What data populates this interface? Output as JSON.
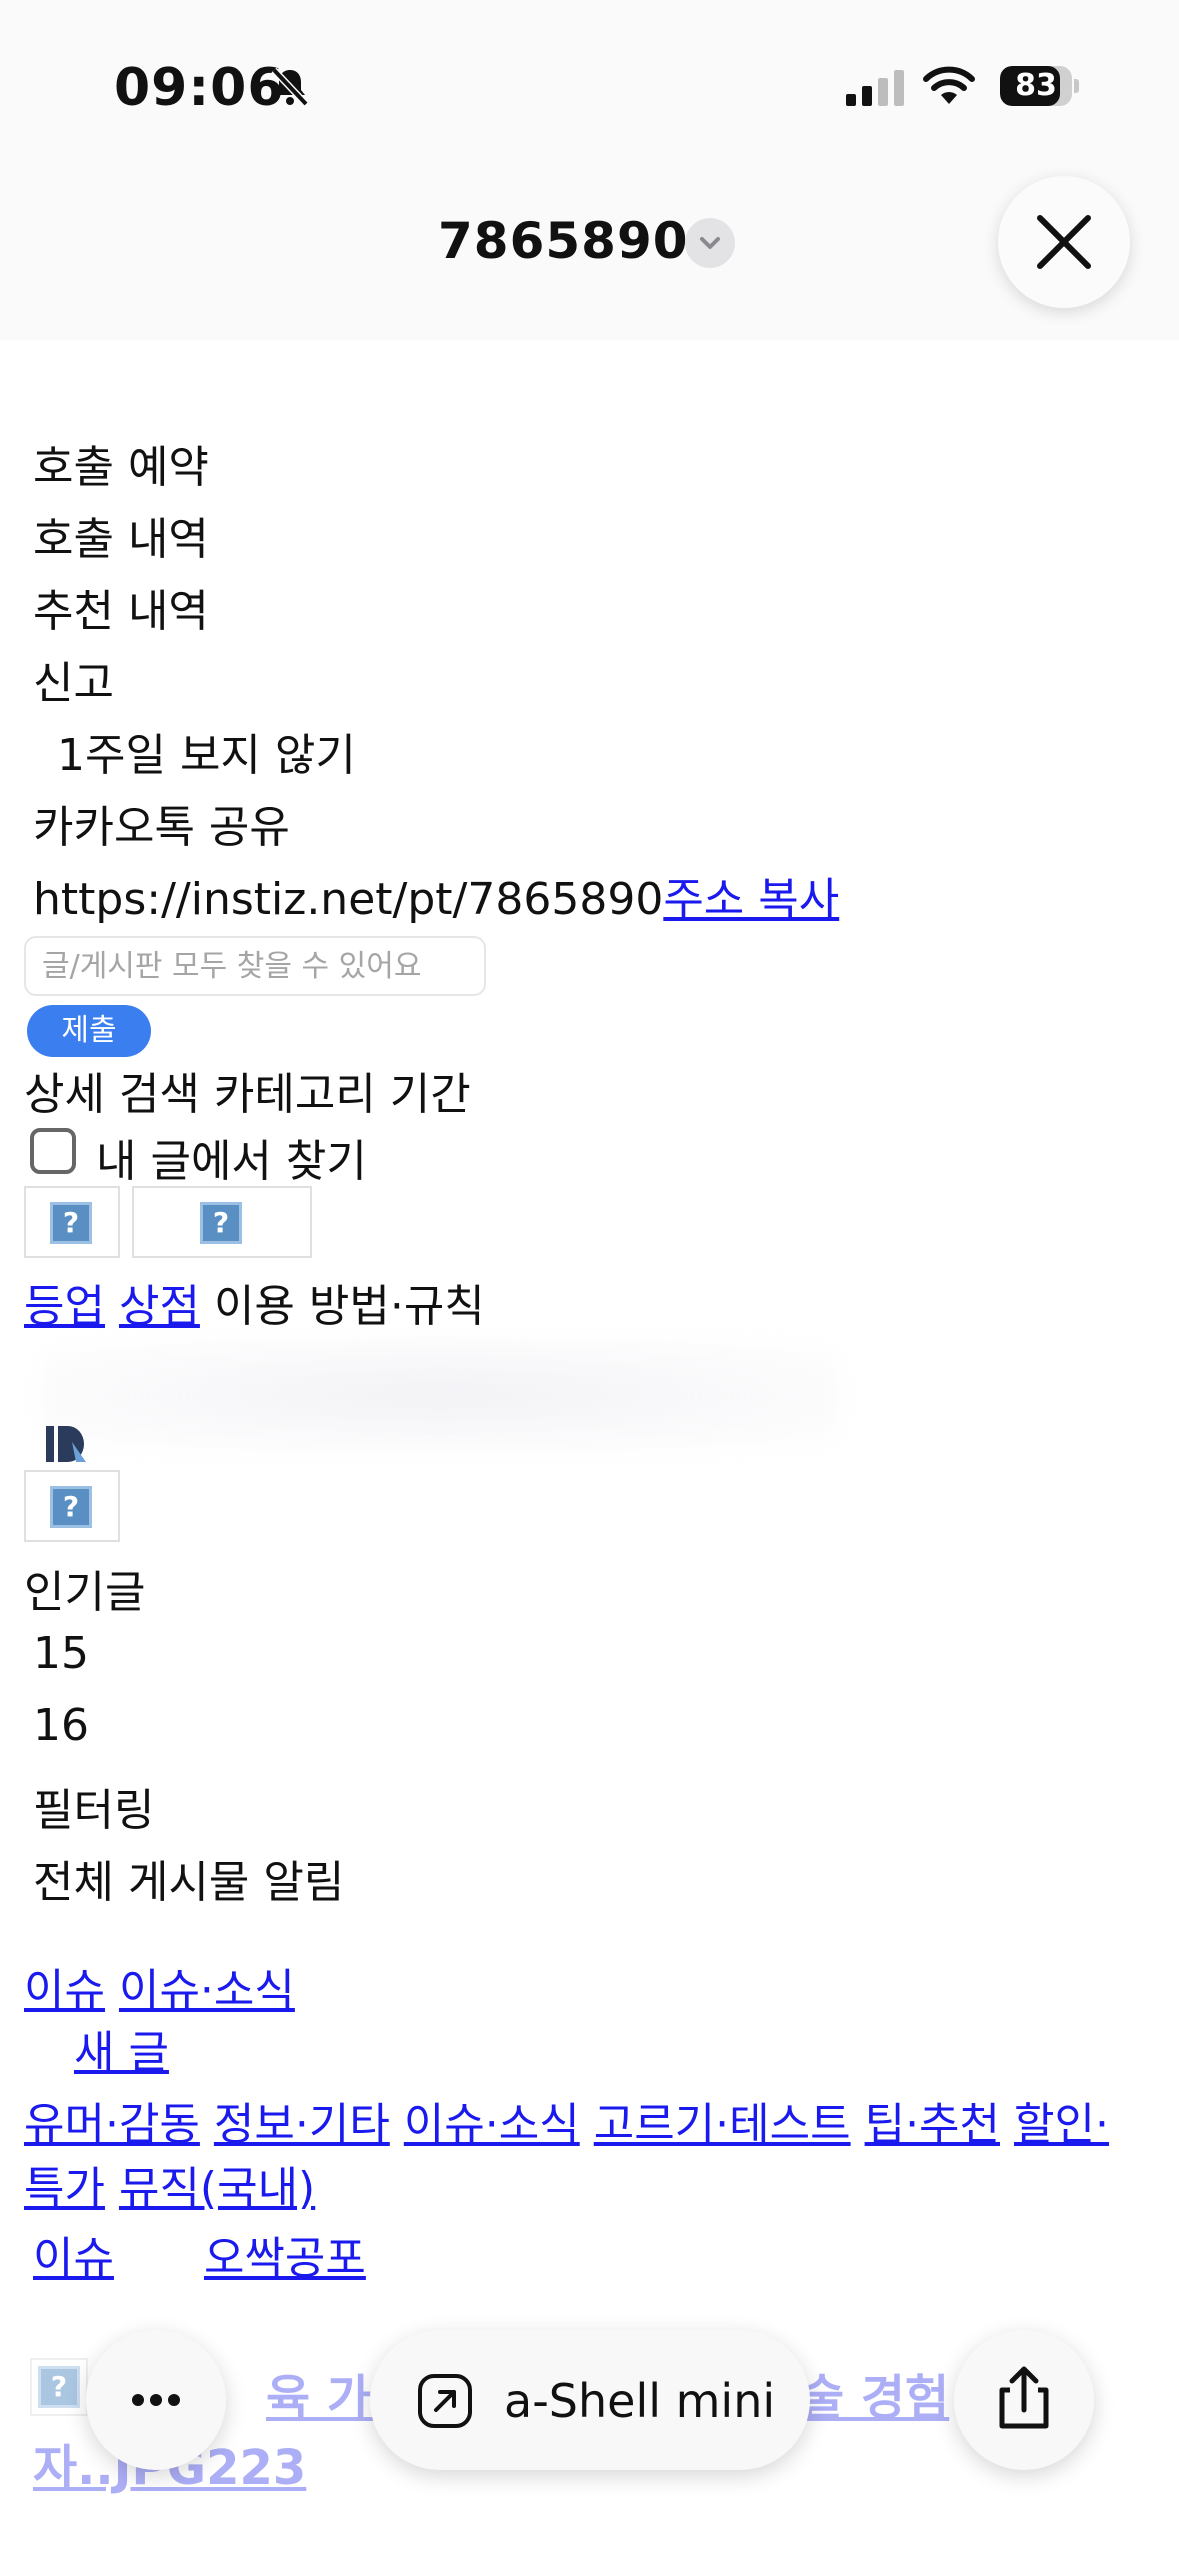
{
  "status_bar": {
    "time": "09:06",
    "battery": "83",
    "battery_level": 0.83
  },
  "header": {
    "title": "7865890"
  },
  "menu": {
    "items": [
      "호출 예약",
      "호출 내역",
      "추천 내역",
      "신고",
      "1주일 보지 않기",
      "카카오톡 공유"
    ],
    "url": "https://instiz.net/pt/7865890",
    "copy_link": "주소 복사"
  },
  "search": {
    "placeholder": "글/게시판 모두 찾을 수 있어요",
    "submit": "제출",
    "options": "상세 검색 카테고리 기간",
    "my_posts_label": "내 글에서 찾기"
  },
  "nav_links": {
    "levelup": "등업",
    "shop": "상점",
    "rules": "이용 방법·규칙"
  },
  "sidebar": {
    "popular": "인기글",
    "num1": "15",
    "num2": "16",
    "filter": "필터링",
    "all_notice": "전체 게시물 알림"
  },
  "board": {
    "issue": "이슈",
    "issue_news": "이슈·소식",
    "new_post": "새 글",
    "categories_line1": [
      "유머·감동",
      "정보·기타",
      "이슈·소식",
      "고르기·테스트",
      "팁·추천",
      "할인·"
    ],
    "categories_line2": [
      "특가",
      "뮤직(국내)"
    ],
    "tab1": "이슈",
    "tab2": "오싹공포"
  },
  "post_preview": {
    "line1_start": "",
    "line1_mid": "육 가슴",
    "line1_end": "술 경험",
    "line2": "자..JPG223"
  },
  "bottom_bar": {
    "app_name": "a-Shell mini"
  }
}
